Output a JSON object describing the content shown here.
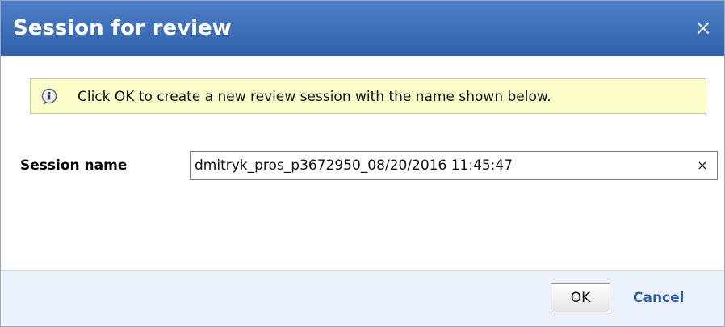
{
  "dialog": {
    "title": "Session for review",
    "close_glyph": "×",
    "close_icon": "close-icon"
  },
  "info": {
    "icon": "info-icon",
    "message": "Click OK to create a new review session with the name shown below."
  },
  "form": {
    "session_name_label": "Session name",
    "session_name_value": "dmitryk_pros_p3672950_08/20/2016 11:45:47",
    "clear_glyph": "×",
    "clear_icon": "clear-icon"
  },
  "footer": {
    "ok_label": "OK",
    "cancel_label": "Cancel"
  },
  "colors": {
    "title_bar": "#3a6db8",
    "info_background": "#fcfcc8",
    "footer_background": "#eaf1fb",
    "link": "#2a5db0"
  }
}
